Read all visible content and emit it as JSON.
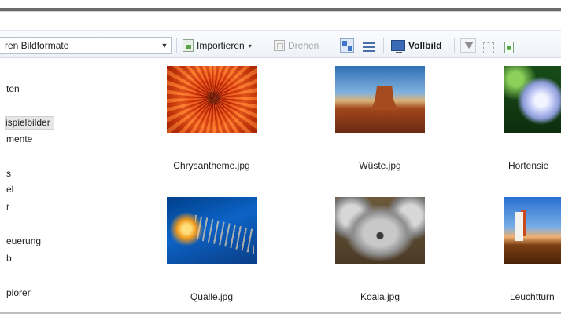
{
  "toolbar": {
    "filter_value": "ren Bildformate",
    "import_label": "Importieren",
    "rotate_label": "Drehen",
    "fullscreen_label": "Vollbild"
  },
  "sidebar": {
    "items": [
      "ten",
      "ispielbilder",
      "mente",
      "s",
      "el",
      "r",
      "euerung",
      "b",
      "plorer"
    ],
    "selected": "ispielbilder"
  },
  "photos": [
    {
      "filename": "Chrysantheme.jpg"
    },
    {
      "filename": "Wüste.jpg"
    },
    {
      "filename": "Hortensie"
    },
    {
      "filename": "Qualle.jpg"
    },
    {
      "filename": "Koala.jpg"
    },
    {
      "filename": "Leuchtturn"
    }
  ]
}
